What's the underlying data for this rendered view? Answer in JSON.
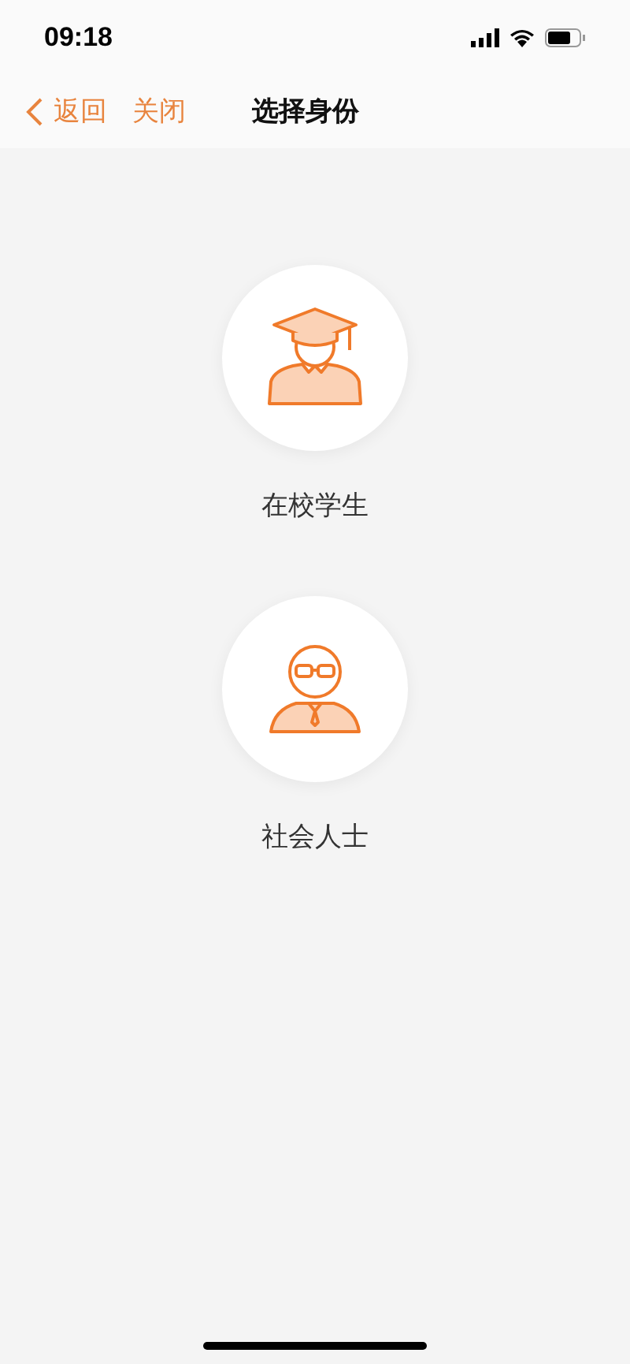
{
  "status_bar": {
    "time": "09:18"
  },
  "nav_bar": {
    "back": "返回",
    "close": "关闭",
    "title": "选择身份"
  },
  "options": [
    {
      "kind": "student",
      "label": "在校学生"
    },
    {
      "kind": "professional",
      "label": "社会人士"
    }
  ]
}
